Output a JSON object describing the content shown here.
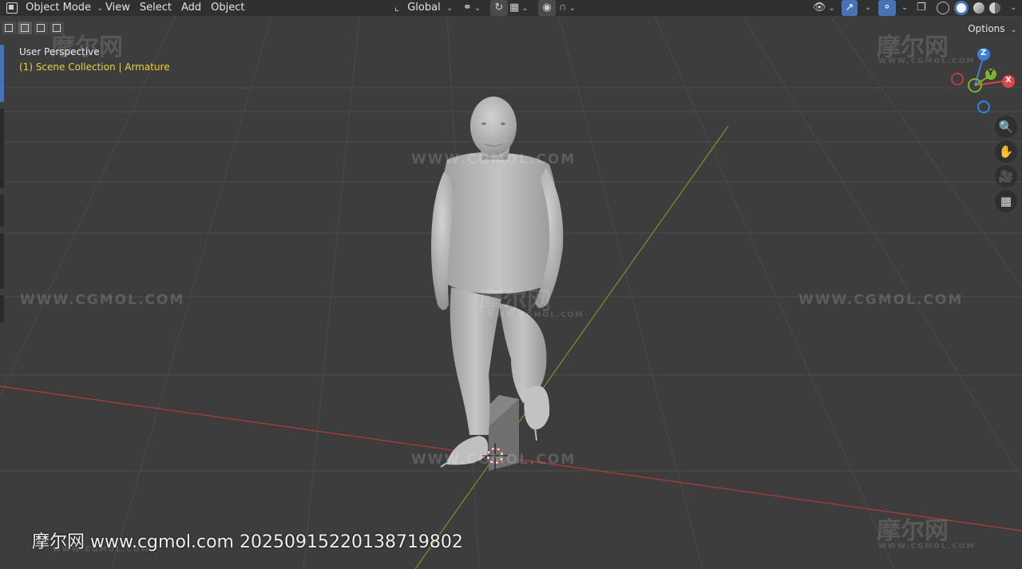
{
  "header": {
    "mode_label": "Object Mode",
    "menus": [
      "View",
      "Select",
      "Add",
      "Object"
    ],
    "transform_orientation": "Global",
    "options_label": "Options"
  },
  "overlay": {
    "perspective": "User Perspective",
    "collection": "(1) Scene Collection | Armature"
  },
  "gizmo": {
    "z": "Z",
    "y": "Y",
    "x": "X"
  },
  "colors": {
    "x_axis": "#e0424a",
    "y_axis": "#7fb233",
    "z_axis": "#3b82d6",
    "active_text": "#e8d14a",
    "accent": "#4772b3"
  },
  "icons": [
    "object-mode-icon",
    "transform-orientation-icon",
    "snap-icon",
    "proportional-edit-icon",
    "visibility-icon",
    "gizmo-icon",
    "overlay-icon",
    "xray-icon",
    "shading-icons",
    "zoom-icon",
    "hand-pan-icon",
    "camera-icon",
    "grid-view-icon"
  ],
  "watermark": {
    "site": "WWW.CGMOL.COM",
    "logo": "摩尔网",
    "logo_sub": "WWW.CGMOL.COM",
    "footer": "摩尔网 www.cgmol.com 20250915220138719802"
  }
}
